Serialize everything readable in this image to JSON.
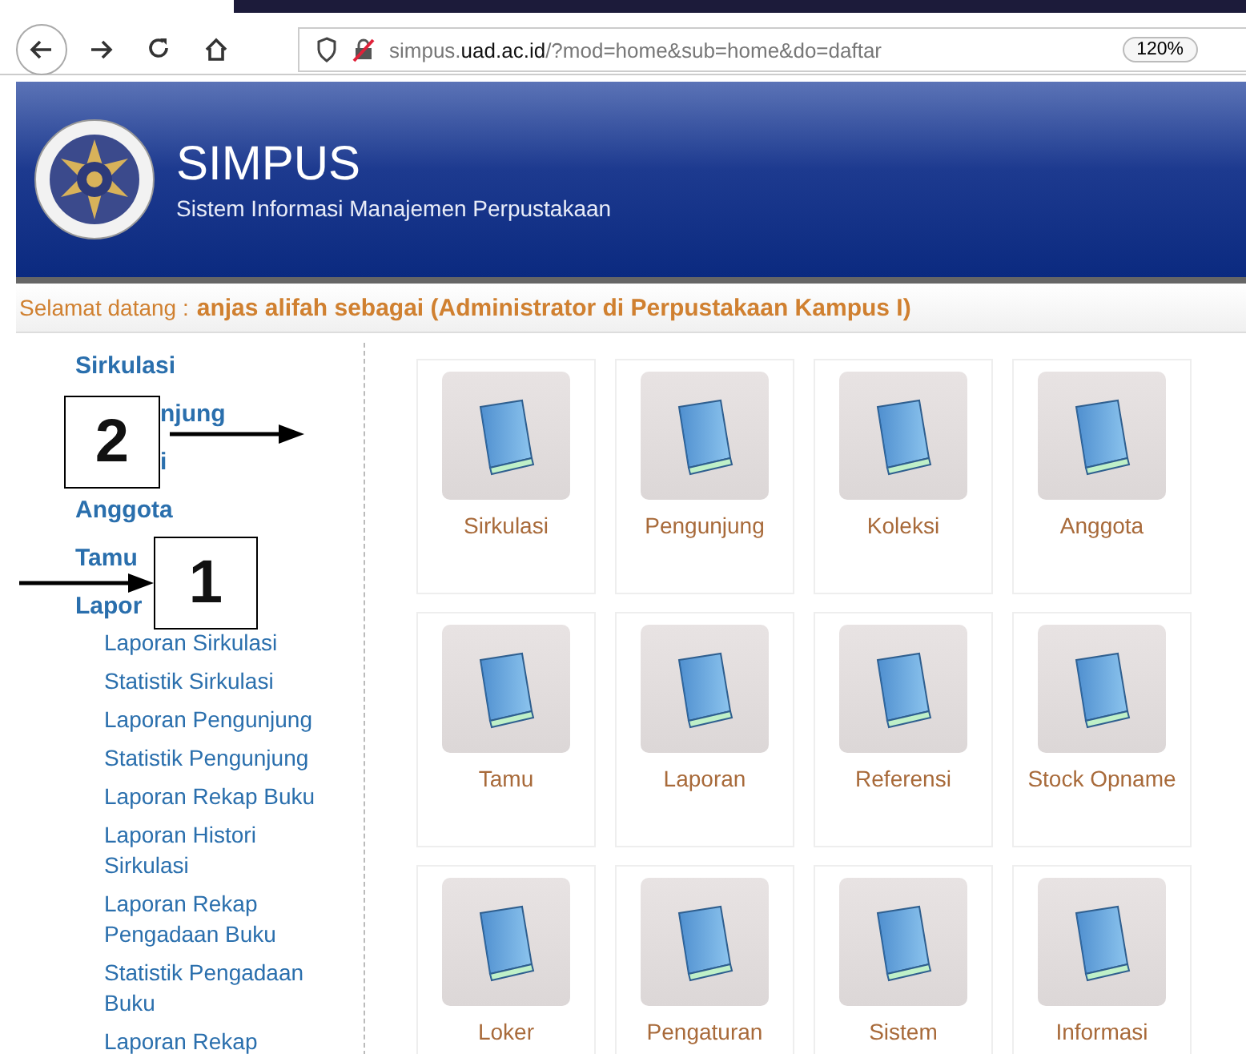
{
  "browser": {
    "url_host_prefix": "simpus.",
    "url_host_domain": "uad.ac.id",
    "url_path": "/?mod=home&sub=home&do=daftar",
    "zoom": "120%"
  },
  "header": {
    "title": "SIMPUS",
    "subtitle": "Sistem Informasi Manajemen Perpustakaan"
  },
  "welcome": {
    "label": "Selamat datang :",
    "user": "anjas alifah sebagai (Administrator di Perpustakaan Kampus I)"
  },
  "sidebar": {
    "items": [
      {
        "label": "Sirkulasi"
      },
      {
        "label": "njung",
        "covered_start": true
      },
      {
        "label": "i",
        "covered_start": true
      },
      {
        "label": "Anggota"
      },
      {
        "label": "Tamu"
      },
      {
        "label": "Lapor",
        "children": [
          {
            "label": "Laporan Sirkulasi"
          },
          {
            "label": "Statistik Sirkulasi"
          },
          {
            "label": "Laporan Pengunjung"
          },
          {
            "label": "Statistik Pengunjung"
          },
          {
            "label": "Laporan Rekap Buku"
          },
          {
            "label": "Laporan Histori Sirkulasi"
          },
          {
            "label": "Laporan Rekap Pengadaan Buku"
          },
          {
            "label": "Statistik Pengadaan Buku"
          },
          {
            "label": "Laporan Rekap"
          }
        ]
      }
    ]
  },
  "tiles": [
    {
      "label": "Sirkulasi"
    },
    {
      "label": "Pengunjung"
    },
    {
      "label": "Koleksi"
    },
    {
      "label": "Anggota"
    },
    {
      "label": "Tamu"
    },
    {
      "label": "Laporan"
    },
    {
      "label": "Referensi"
    },
    {
      "label": "Stock Opname"
    },
    {
      "label": "Loker"
    },
    {
      "label": "Pengaturan"
    },
    {
      "label": "Sistem"
    },
    {
      "label": "Informasi"
    }
  ],
  "annotations": [
    {
      "label": "2",
      "kind": "arrow-right-from-box"
    },
    {
      "label": "1",
      "kind": "arrow-into-box"
    }
  ]
}
